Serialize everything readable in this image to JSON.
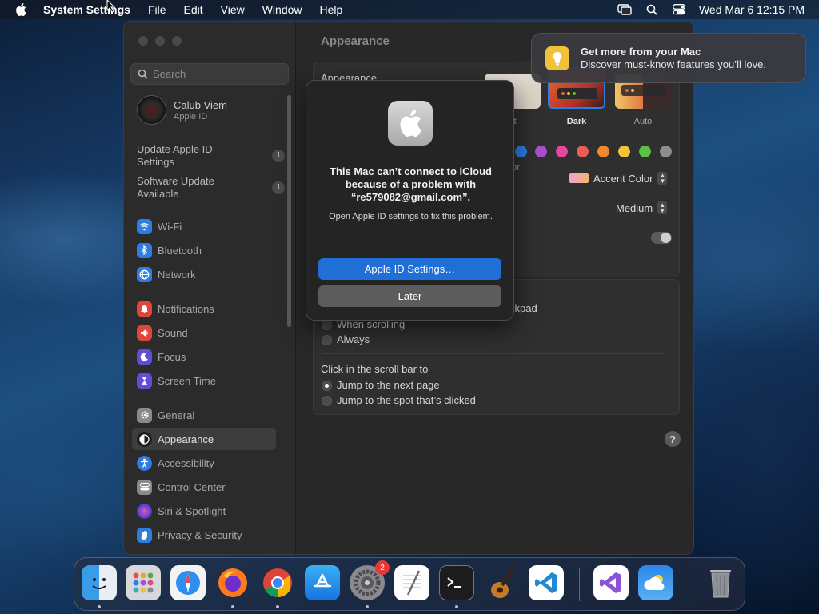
{
  "menubar": {
    "app_name": "System Settings",
    "menus": [
      "File",
      "Edit",
      "View",
      "Window",
      "Help"
    ],
    "clock": "Wed Mar 6  12:15 PM"
  },
  "sidebar": {
    "search_placeholder": "Search",
    "profile": {
      "name": "Calub Viem",
      "subtitle": "Apple ID"
    },
    "updates": [
      {
        "label": "Update Apple ID Settings",
        "badge": "1"
      },
      {
        "label": "Software Update Available",
        "badge": "1"
      }
    ],
    "items": [
      {
        "label": "Wi-Fi",
        "icon": "wifi-icon",
        "color": "#2f7de1"
      },
      {
        "label": "Bluetooth",
        "icon": "bluetooth-icon",
        "color": "#2f7de1"
      },
      {
        "label": "Network",
        "icon": "globe-icon",
        "color": "#2f7de1"
      },
      {
        "label": "Notifications",
        "icon": "bell-icon",
        "color": "#e0453a"
      },
      {
        "label": "Sound",
        "icon": "speaker-icon",
        "color": "#e0453a"
      },
      {
        "label": "Focus",
        "icon": "moon-icon",
        "color": "#5e4fd6"
      },
      {
        "label": "Screen Time",
        "icon": "hourglass-icon",
        "color": "#5e4fd6"
      },
      {
        "label": "General",
        "icon": "gear-icon",
        "color": "#8a8a8a"
      },
      {
        "label": "Appearance",
        "icon": "appearance-icon",
        "color": "#2b2b2b",
        "active": true
      },
      {
        "label": "Accessibility",
        "icon": "accessibility-icon",
        "color": "#2f7de1"
      },
      {
        "label": "Control Center",
        "icon": "control-center-icon",
        "color": "#8a8a8a"
      },
      {
        "label": "Siri & Spotlight",
        "icon": "siri-icon",
        "color": "#9b3fd0"
      },
      {
        "label": "Privacy & Security",
        "icon": "hand-icon",
        "color": "#2f7de1"
      }
    ]
  },
  "main": {
    "title": "Appearance",
    "appearance_label": "Appearance",
    "themes": [
      {
        "label": "Light",
        "visible_caption": "nt"
      },
      {
        "label": "Dark"
      },
      {
        "label": "Auto"
      }
    ],
    "accent_label_partial": "or",
    "accent_colors": [
      "#2f7de1",
      "#a550c8",
      "#e5489a",
      "#ec5b55",
      "#f08a2c",
      "#f2c43a",
      "#5bbf4a",
      "#8e8e8e"
    ],
    "highlight_value": "Accent Color",
    "sidebar_icon_size_value": "Medium",
    "scroll_section_partial": "ckpad",
    "scroll_options": [
      "When scrolling",
      "Always"
    ],
    "click_scroll_label": "Click in the scroll bar to",
    "click_options": [
      "Jump to the next page",
      "Jump to the spot that’s clicked"
    ],
    "help": "?"
  },
  "dialog": {
    "title": "This Mac can’t connect to iCloud because of a problem with “re579082@gmail.com”.",
    "message": "Open Apple ID settings to fix this problem.",
    "primary_button": "Apple ID Settings…",
    "secondary_button": "Later"
  },
  "notification": {
    "title": "Get more from your Mac",
    "body": "Discover must-know features you’ll love."
  },
  "dock": {
    "apps": [
      "Finder",
      "Launchpad",
      "Safari",
      "Firefox",
      "Chrome",
      "App Store",
      "System Settings",
      "TextEdit",
      "Terminal",
      "GarageBand",
      "Visual Studio Code",
      "Visual Studio",
      "Weather",
      "Trash"
    ],
    "settings_badge": "2"
  }
}
